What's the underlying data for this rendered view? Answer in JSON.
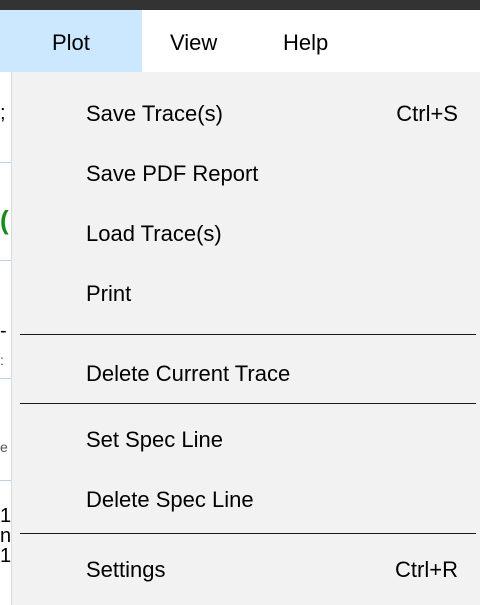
{
  "menubar": {
    "items": [
      {
        "label": "Plot"
      },
      {
        "label": "View"
      },
      {
        "label": "Help"
      }
    ]
  },
  "background": {
    "glyphs": [
      ";",
      "(",
      "-",
      ":",
      "e",
      "1",
      "n",
      "1"
    ]
  },
  "plot_menu": {
    "items": [
      {
        "label": "Save Trace(s)",
        "shortcut": "Ctrl+S"
      },
      {
        "label": "Save PDF Report",
        "shortcut": ""
      },
      {
        "label": "Load Trace(s)",
        "shortcut": ""
      },
      {
        "label": "Print",
        "shortcut": ""
      },
      {
        "label": "Delete Current Trace",
        "shortcut": ""
      },
      {
        "label": "Set Spec Line",
        "shortcut": ""
      },
      {
        "label": "Delete Spec Line",
        "shortcut": ""
      },
      {
        "label": "Settings",
        "shortcut": "Ctrl+R"
      }
    ]
  },
  "colors": {
    "menubar_active_highlight": "#cce8ff",
    "dropdown_background": "#f2f2f2",
    "separator": "#1a1a1a"
  }
}
